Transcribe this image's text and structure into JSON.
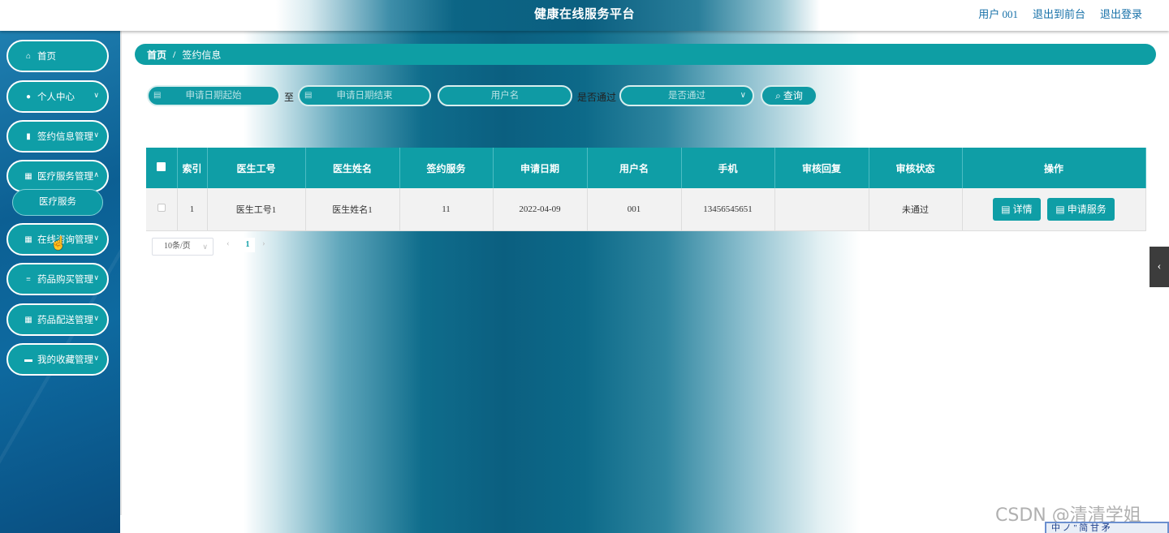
{
  "header": {
    "title": "健康在线服务平台",
    "user_label": "用户 001",
    "front_label": "退出到前台",
    "logout_label": "退出登录"
  },
  "sidebar": {
    "items": [
      {
        "label": "首页",
        "icon": "home-icon"
      },
      {
        "label": "个人中心",
        "icon": "user-icon"
      },
      {
        "label": "签约信息管理",
        "icon": "bar-chart-icon"
      },
      {
        "label": "医疗服务管理",
        "icon": "grid-icon"
      },
      {
        "label": "在线咨询管理",
        "icon": "grid-icon"
      },
      {
        "label": "药品购买管理",
        "icon": "list-icon"
      },
      {
        "label": "药品配送管理",
        "icon": "grid-icon"
      },
      {
        "label": "我的收藏管理",
        "icon": "monitor-icon"
      }
    ],
    "submenu": {
      "label": "医疗服务"
    }
  },
  "breadcrumb": {
    "home": "首页",
    "separator": "/",
    "current": "签约信息"
  },
  "search": {
    "date_start_placeholder": "申请日期起始",
    "to_label": "至",
    "date_end_placeholder": "申请日期结束",
    "username_placeholder": "用户名",
    "pass_label": "是否通过",
    "pass_placeholder": "是否通过",
    "search_label": "查询"
  },
  "table": {
    "columns": [
      "索引",
      "医生工号",
      "医生姓名",
      "签约服务",
      "申请日期",
      "用户名",
      "手机",
      "审核回复",
      "审核状态",
      "操作"
    ],
    "rows": [
      {
        "index": "1",
        "doctor_id": "医生工号1",
        "doctor_name": "医生姓名1",
        "service": "11",
        "date": "2022-04-09",
        "username": "001",
        "phone": "13456545651",
        "reply": "",
        "status": "未通过",
        "detail_label": "详情",
        "apply_label": "申请服务"
      }
    ]
  },
  "pagination": {
    "page_size": "10条/页",
    "current_page": "1"
  },
  "watermark": "CSDN @清清学姐",
  "ime_text": "中 ノ '' 简 甘 矛",
  "colors": {
    "teal": "#0f9ea6",
    "sidebar_blue": "#0c5f93",
    "link": "#1670a8"
  }
}
